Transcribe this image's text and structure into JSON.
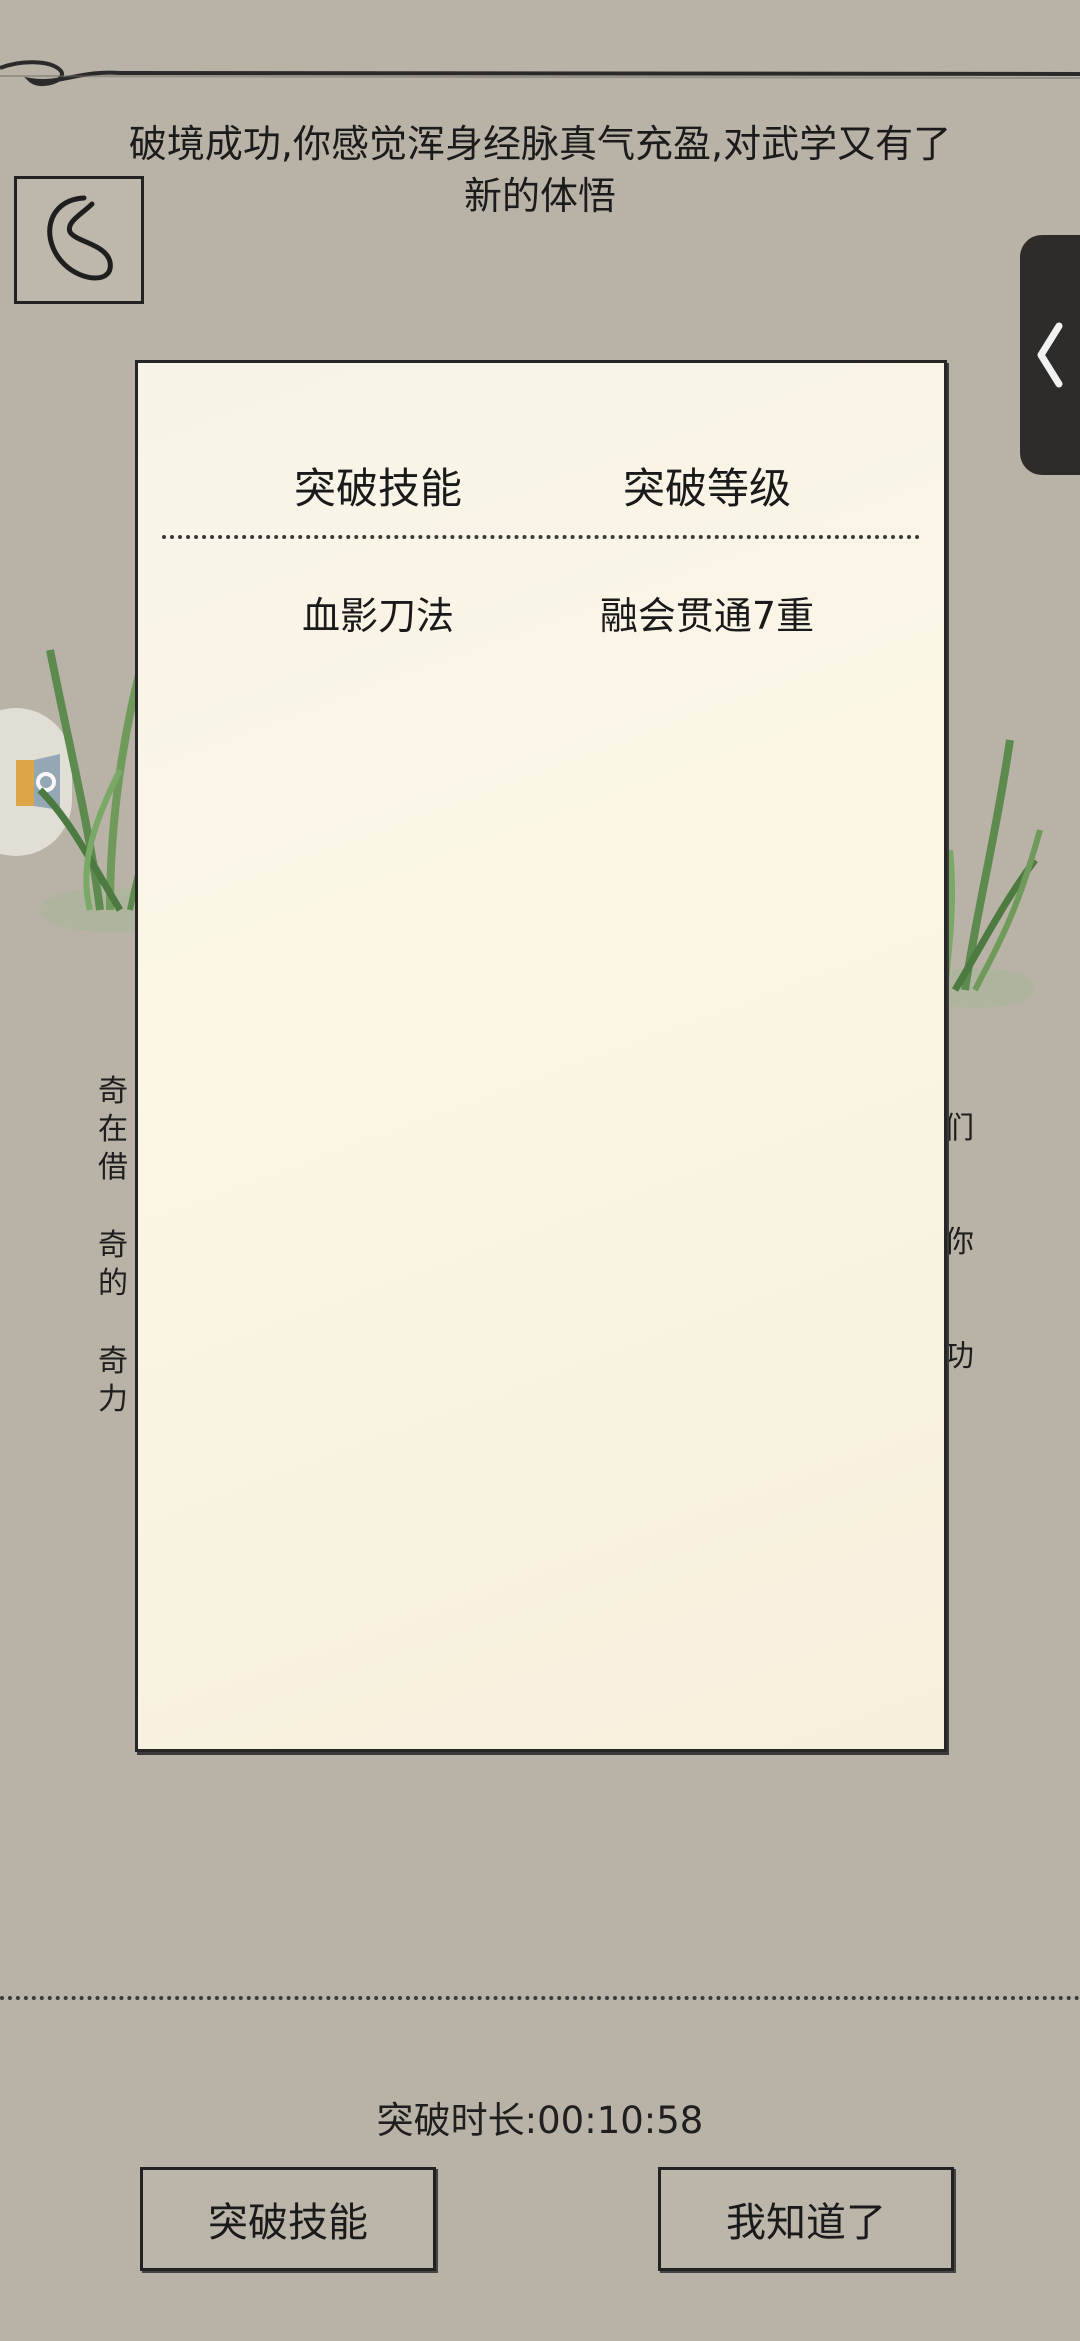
{
  "header": {
    "message": "破境成功,你感觉浑身经脉真气充盈,对武学又有了新的体悟",
    "back_icon": "back-curl-icon"
  },
  "side_tab": {
    "icon": "chevron-left-icon"
  },
  "background_text": {
    "left_column": [
      "奇",
      "在",
      "借",
      "",
      "奇",
      "的",
      "",
      "奇",
      "力"
    ],
    "right_column": [
      "们",
      "",
      "你",
      "",
      "功"
    ]
  },
  "modal": {
    "headers": [
      "突破技能",
      "突破等级"
    ],
    "rows": [
      {
        "skill": "血影刀法",
        "level": "融会贯通7重"
      }
    ]
  },
  "footer": {
    "duration_label": "突破时长:",
    "duration_value": "00:10:58",
    "buttons": [
      "突破技能",
      "我知道了"
    ]
  },
  "colors": {
    "background": "#b8b3a6",
    "modal": "#f9f4e4",
    "grass": "#5d8a4e",
    "side_tab": "#2f2b29"
  }
}
